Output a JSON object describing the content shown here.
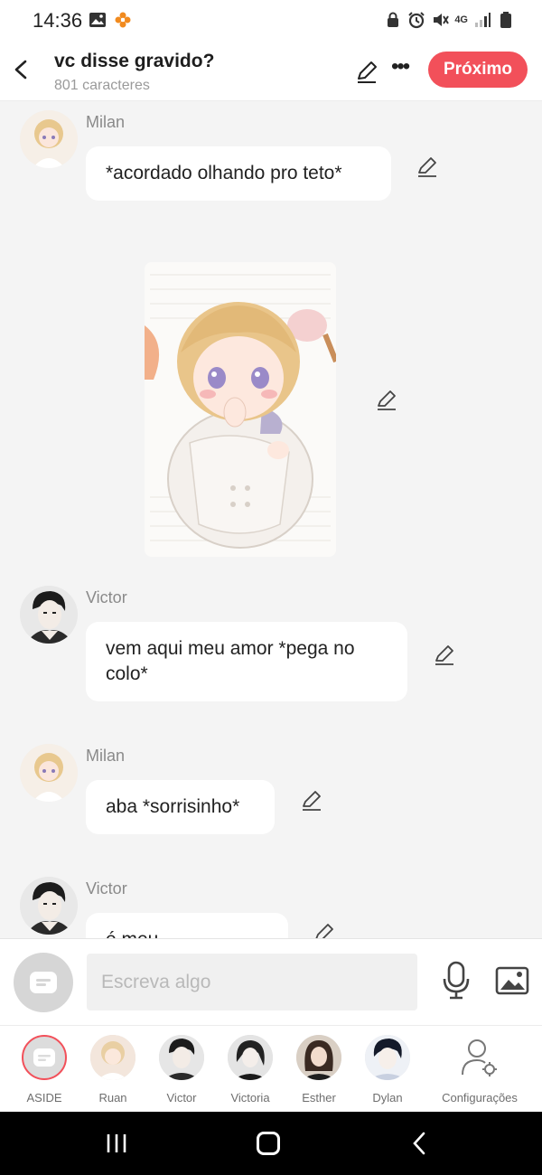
{
  "status_bar": {
    "time": "14:36",
    "network": "4G",
    "left_icons": [
      "gallery-icon",
      "flower-icon"
    ],
    "right_icons": [
      "lock-icon",
      "alarm-icon",
      "mute-icon",
      "network-icon",
      "signal-icon",
      "battery-icon"
    ]
  },
  "header": {
    "title": "vc disse gravido?",
    "subtitle": "801 caracteres",
    "next_label": "Próximo"
  },
  "messages": [
    {
      "sender": "Milan",
      "text": "*acordado olhando pro teto*"
    },
    {
      "sender": "",
      "text": "",
      "type": "image"
    },
    {
      "sender": "Victor",
      "text": "vem aqui meu amor *pega no colo*"
    },
    {
      "sender": "Milan",
      "text": "aba *sorrisinho*"
    },
    {
      "sender": "Victor",
      "text": "é meu pinguinzinho"
    }
  ],
  "composer": {
    "placeholder": "Escreva algo"
  },
  "characters": [
    {
      "name": "ASIDE",
      "active": true
    },
    {
      "name": "Ruan"
    },
    {
      "name": "Victor"
    },
    {
      "name": "Victoria"
    },
    {
      "name": "Esther"
    },
    {
      "name": "Dylan"
    },
    {
      "name": "Configurações"
    }
  ],
  "colors": {
    "accent": "#f2505a",
    "background": "#f4f4f4",
    "bubble": "#ffffff"
  }
}
